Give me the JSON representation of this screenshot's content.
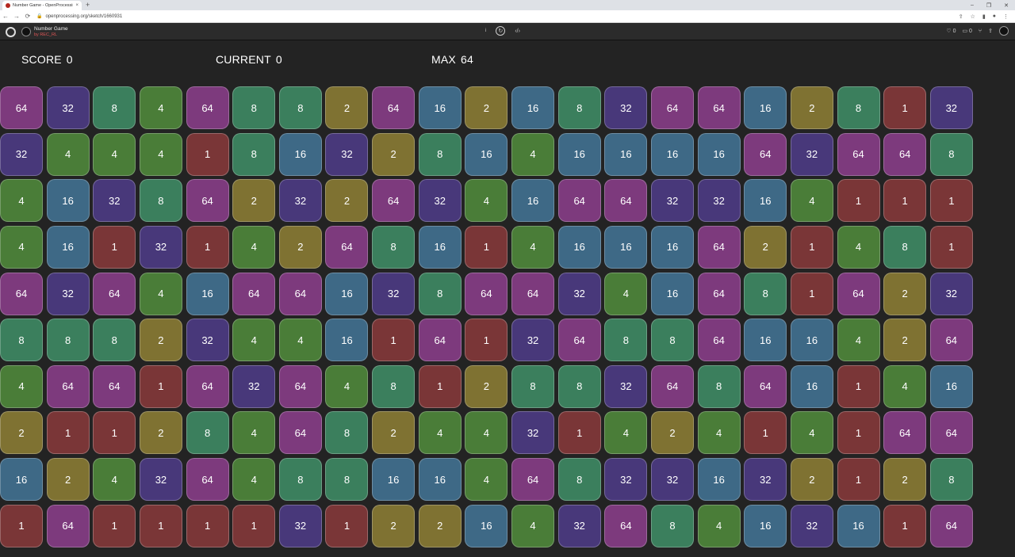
{
  "browser": {
    "tab_title": "Number Game - OpenProcessing",
    "tab_close": "×",
    "new_tab": "+",
    "url": "openprocessing.org/sketch/1660931",
    "nav": {
      "back": "←",
      "forward": "→",
      "reload": "⟳"
    },
    "window_controls": {
      "minimize": "–",
      "restore": "❐",
      "close": "✕"
    },
    "toolbar_icons": {
      "share": "⇪",
      "star": "☆",
      "extensions": "▮",
      "profile": "●",
      "menu": "⋮"
    }
  },
  "header": {
    "sketch_title": "Number Game",
    "author": "by REC_RL",
    "info": "i",
    "replay": "↻",
    "code": "‹/›",
    "hearts": "♡ 0",
    "comments": "▭ 0",
    "fork": "⑂",
    "share": "⇪"
  },
  "stats": {
    "score_label": "SCORE",
    "score": "0",
    "current_label": "CURRENT",
    "current": "0",
    "max_label": "MAX",
    "max": "64"
  },
  "colors": {
    "1": "#7a3637",
    "2": "#7f7232",
    "4": "#4a7d38",
    "8": "#3b7f5d",
    "16": "#3e6986",
    "32": "#48387a",
    "64": "#7d3a7d"
  },
  "grid": [
    [
      64,
      32,
      8,
      4,
      64,
      8,
      8,
      2,
      64,
      16,
      2,
      16,
      8,
      32,
      64,
      64,
      16,
      2,
      8,
      1,
      32
    ],
    [
      32,
      4,
      4,
      4,
      1,
      8,
      16,
      32,
      2,
      8,
      16,
      4,
      16,
      16,
      16,
      16,
      64,
      32,
      64,
      64,
      8
    ],
    [
      4,
      16,
      32,
      8,
      64,
      2,
      32,
      2,
      64,
      32,
      4,
      16,
      64,
      64,
      32,
      32,
      16,
      4,
      1,
      1,
      1
    ],
    [
      4,
      16,
      1,
      32,
      1,
      4,
      2,
      64,
      8,
      16,
      1,
      4,
      16,
      16,
      16,
      64,
      2,
      1,
      4,
      8,
      1
    ],
    [
      64,
      32,
      64,
      4,
      16,
      64,
      64,
      16,
      32,
      8,
      64,
      64,
      32,
      4,
      16,
      64,
      8,
      1,
      64,
      2,
      32
    ],
    [
      8,
      8,
      8,
      2,
      32,
      4,
      4,
      16,
      1,
      64,
      1,
      32,
      64,
      8,
      8,
      64,
      16,
      16,
      4,
      2,
      64
    ],
    [
      4,
      64,
      64,
      1,
      64,
      32,
      64,
      4,
      8,
      1,
      2,
      8,
      8,
      32,
      64,
      8,
      64,
      16,
      1,
      4,
      16
    ],
    [
      2,
      1,
      1,
      2,
      8,
      4,
      64,
      8,
      2,
      4,
      4,
      32,
      1,
      4,
      2,
      4,
      1,
      4,
      1,
      64,
      64
    ],
    [
      16,
      2,
      4,
      32,
      64,
      4,
      8,
      8,
      16,
      16,
      4,
      64,
      8,
      32,
      32,
      16,
      32,
      2,
      1,
      2,
      8
    ],
    [
      1,
      64,
      1,
      1,
      1,
      1,
      32,
      1,
      2,
      2,
      16,
      4,
      32,
      64,
      8,
      4,
      16,
      32,
      16,
      1,
      64
    ]
  ]
}
